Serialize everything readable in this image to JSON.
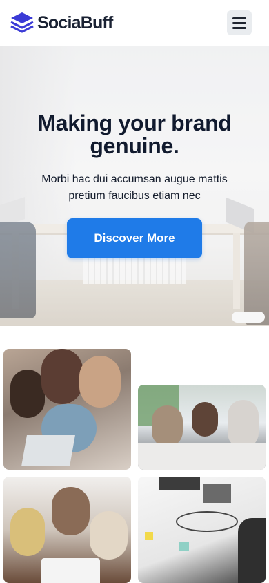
{
  "header": {
    "brand": "SociaBuff",
    "logo_icon": "stacked-layers-icon",
    "menu_icon": "hamburger-menu-icon",
    "accent_color": "#3b3bd6"
  },
  "hero": {
    "title_line1": "Making your brand",
    "title_line2": "genuine.",
    "subtitle_line1": "Morbi hac dui accumsan augue mattis",
    "subtitle_line2": "pretium faucibus etiam nec",
    "cta_label": "Discover More",
    "cta_color": "#1f7be8"
  },
  "gallery": [
    {
      "name": "team-laptop-photo"
    },
    {
      "name": "meeting-table-photo"
    },
    {
      "name": "group-laughing-photo"
    },
    {
      "name": "creative-process-photo"
    }
  ]
}
